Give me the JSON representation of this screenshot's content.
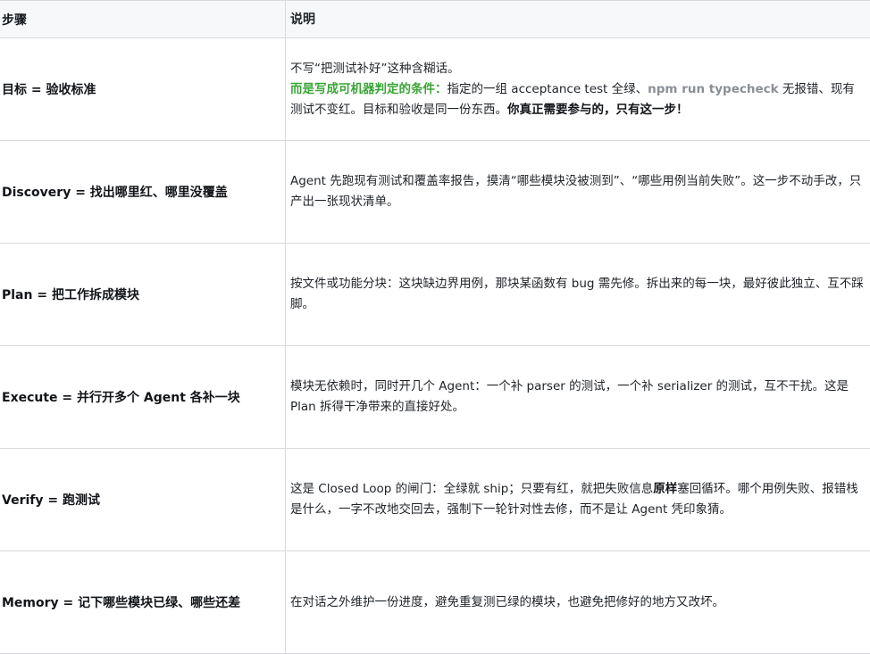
{
  "table": {
    "headers": {
      "step": "步骤",
      "desc": "说明"
    },
    "rows": [
      {
        "step": "目标 = 验收标准",
        "desc": [
          {
            "text": "不写“把测试补好”这种含糊话。"
          },
          {
            "break": true
          },
          {
            "text": "而是写成可机器判定的条件：",
            "style": "green"
          },
          {
            "text": "指定的一组 acceptance test 全绿、"
          },
          {
            "text": "npm run typecheck",
            "style": "code"
          },
          {
            "text": " 无报错、现有测试不变红。目标和验收是同一份东西。"
          },
          {
            "text": "你真正需要参与的，只有这一步！",
            "style": "strong"
          }
        ]
      },
      {
        "step": "Discovery = 找出哪里红、哪里没覆盖",
        "desc": [
          {
            "text": "Agent 先跑现有测试和覆盖率报告，摸清“哪些模块没被测到”、“哪些用例当前失败”。这一步不动手改，只产出一张现状清单。"
          }
        ]
      },
      {
        "step": "Plan = 把工作拆成模块",
        "desc": [
          {
            "text": "按文件或功能分块：这块缺边界用例，那块某函数有 bug 需先修。拆出来的每一块，最好彼此独立、互不踩脚。"
          }
        ]
      },
      {
        "step": "Execute = 并行开多个 Agent 各补一块",
        "desc": [
          {
            "text": "模块无依赖时，同时开几个 Agent：一个补 parser 的测试，一个补 serializer 的测试，互不干扰。这是 Plan 拆得干净带来的直接好处。"
          }
        ]
      },
      {
        "step": "Verify = 跑测试",
        "desc": [
          {
            "text": "这是 Closed Loop 的闸门：全绿就 ship；只要有红，就把失败信息"
          },
          {
            "text": "原样",
            "style": "strong"
          },
          {
            "text": "塞回循环。哪个用例失败、报错栈是什么，一字不改地交回去，强制下一轮针对性去修，而不是让 Agent 凭印象猜。"
          }
        ]
      },
      {
        "step": "Memory = 记下哪些模块已绿、哪些还差",
        "desc": [
          {
            "text": "在对话之外维护一份进度，避免重复测已绿的模块，也避免把修好的地方又改坏。"
          }
        ]
      }
    ]
  }
}
